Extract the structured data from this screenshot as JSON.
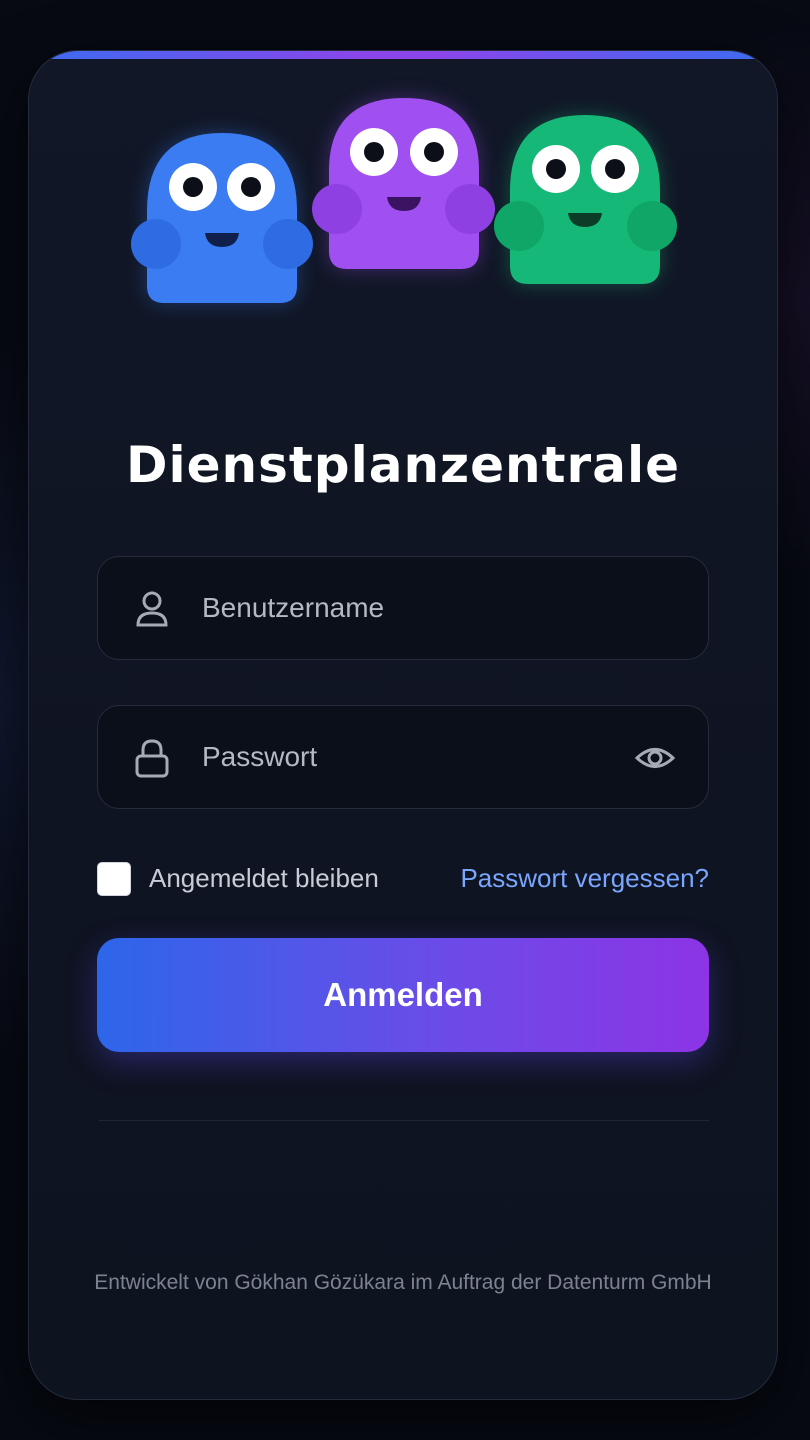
{
  "app": {
    "title": "Dienstplanzentrale"
  },
  "mascots": {
    "icon_names": [
      "blue-mascot-icon",
      "purple-mascot-icon",
      "green-mascot-icon"
    ],
    "colors": [
      "#3b7cf2",
      "#a04ff0",
      "#16b877"
    ]
  },
  "login_form": {
    "username": {
      "placeholder": "Benutzername",
      "value": "",
      "icon": "user-icon"
    },
    "password": {
      "placeholder": "Passwort",
      "value": "",
      "icon": "lock-icon",
      "toggle_icon": "eye-icon"
    },
    "remember_me": {
      "label": "Angemeldet bleiben",
      "checked": false
    },
    "forgot_password": "Passwort vergessen?",
    "submit_label": "Anmelden"
  },
  "footer": {
    "credit": "Entwickelt von Gökhan Gözükara im Auftrag der Datenturm GmbH"
  },
  "colors": {
    "background": "#070a13",
    "card": "#111727",
    "accent_blue": "#2d66ea",
    "accent_purple": "#8d34e6",
    "link": "#79a6ff"
  }
}
